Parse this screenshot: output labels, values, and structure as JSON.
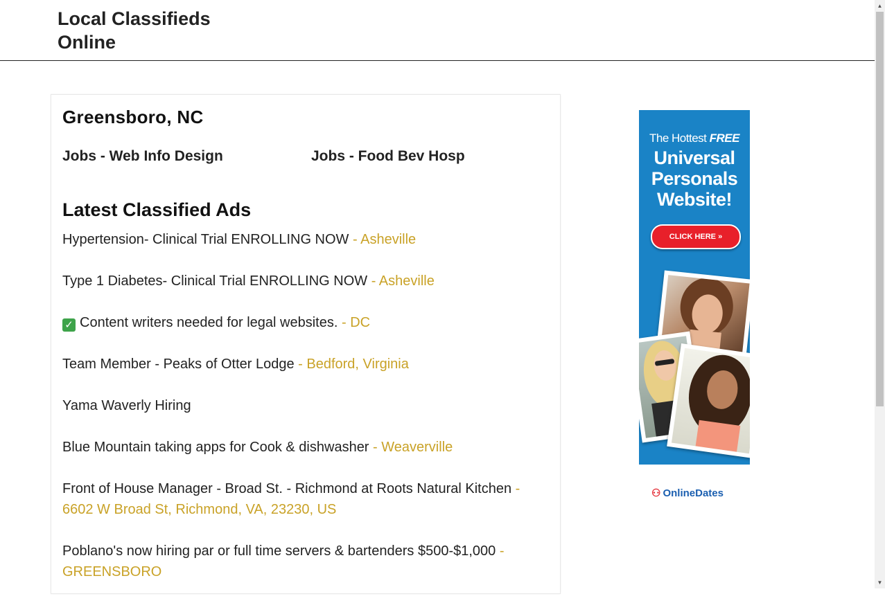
{
  "site": {
    "title": "Local Classifieds Online"
  },
  "main": {
    "city": "Greensboro, NC",
    "categories": [
      {
        "label": "Jobs - Web Info Design"
      },
      {
        "label": "Jobs - Food Bev Hosp"
      }
    ],
    "latest_heading": "Latest Classified Ads",
    "ads": [
      {
        "title": "Hypertension- Clinical Trial ENROLLING NOW",
        "location": " - Asheville"
      },
      {
        "title": "Type 1 Diabetes- Clinical Trial ENROLLING NOW",
        "location": " - Asheville"
      },
      {
        "title": "Content writers needed for legal websites.",
        "location": " - DC"
      },
      {
        "title": "Team Member - Peaks of Otter Lodge",
        "location": " - Bedford, Virginia"
      },
      {
        "title": "Yama Waverly Hiring",
        "location": ""
      },
      {
        "title": "Blue Mountain taking apps for Cook & dishwasher",
        "location": " - Weaverville"
      },
      {
        "title": "Front of House Manager - Broad St. - Richmond at Roots Natural Kitchen",
        "location": " - 6602 W Broad St, Richmond, VA, 23230, US"
      },
      {
        "title": "Poblano's now hiring par or full time servers & bartenders $500-$1,000",
        "location": " - GREENSBORO"
      }
    ]
  },
  "ad_banner": {
    "line1_prefix": "The Hottest ",
    "line1_emphasis": "FREE",
    "headline_1": "Universal",
    "headline_2": "Personals",
    "headline_3": "Website!",
    "button_label": "CLICK HERE »",
    "brand": "OnlineDates"
  },
  "colors": {
    "location_link": "#c9a227",
    "banner_bg": "#1a83c6",
    "button_red": "#e8202a"
  },
  "icons": {
    "checkmark": "check-mark-emoji",
    "brand_logo": "onlinedates-logo"
  }
}
